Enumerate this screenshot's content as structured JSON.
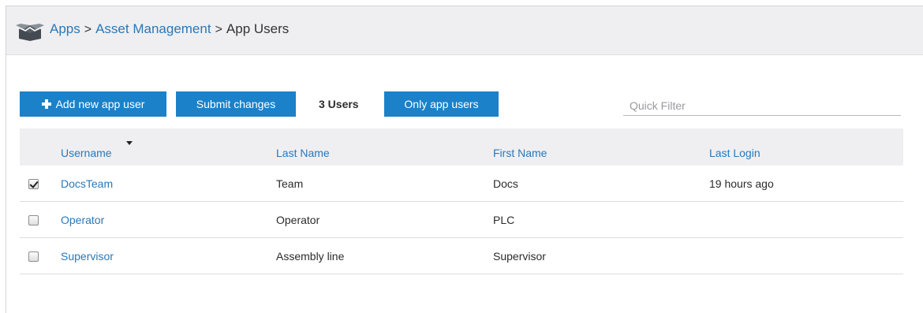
{
  "breadcrumb": {
    "apps": "Apps",
    "asset_management": "Asset Management",
    "current": "App Users",
    "separator": ">"
  },
  "toolbar": {
    "add_label": "Add new app user",
    "submit_label": "Submit changes",
    "user_count": "3 Users",
    "only_app_users_label": "Only app users",
    "filter_placeholder": "Quick Filter"
  },
  "table": {
    "columns": [
      "Username",
      "Last Name",
      "First Name",
      "Last Login"
    ],
    "sort_column": "Username",
    "rows": [
      {
        "selected": true,
        "username": "DocsTeam",
        "last_name": "Team",
        "first_name": "Docs",
        "last_login": "19 hours ago"
      },
      {
        "selected": false,
        "username": "Operator",
        "last_name": "Operator",
        "first_name": "PLC",
        "last_login": ""
      },
      {
        "selected": false,
        "username": "Supervisor",
        "last_name": "Assembly line",
        "first_name": "Supervisor",
        "last_login": ""
      }
    ]
  },
  "colors": {
    "accent": "#1b81c9",
    "link": "#2a78b8",
    "header_bg": "#efeff2"
  }
}
